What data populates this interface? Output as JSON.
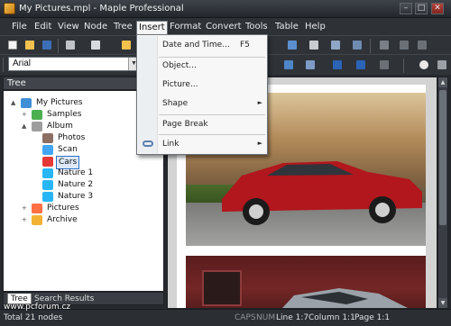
{
  "window": {
    "title": "My Pictures.mpl - Maple Professional",
    "minimize_glyph": "–",
    "maximize_glyph": "□",
    "close_glyph": "✕"
  },
  "menubar": {
    "items": [
      {
        "key": "file",
        "label": "File"
      },
      {
        "key": "edit",
        "label": "Edit"
      },
      {
        "key": "view",
        "label": "View"
      },
      {
        "key": "node",
        "label": "Node"
      },
      {
        "key": "tree",
        "label": "Tree"
      },
      {
        "key": "insert",
        "label": "Insert"
      },
      {
        "key": "format",
        "label": "Format"
      },
      {
        "key": "convert",
        "label": "Convert"
      },
      {
        "key": "tools",
        "label": "Tools"
      },
      {
        "key": "table",
        "label": "Table"
      },
      {
        "key": "help",
        "label": "Help"
      }
    ],
    "open_menu": "Insert"
  },
  "insert_menu": {
    "items": [
      {
        "label": "Date and Time...",
        "shortcut": "F5"
      },
      {
        "label": "Object..."
      },
      {
        "label": "Picture..."
      },
      {
        "label": "Shape",
        "submenu": "►"
      },
      {
        "label": "Page Break"
      },
      {
        "label": "Link",
        "submenu": "►"
      }
    ]
  },
  "format_toolbar": {
    "font_name": "Arial",
    "font_dropdown_glyph": "▼"
  },
  "tree": {
    "header": "Tree",
    "pin_glyph": "⊥",
    "nodes": [
      {
        "label": "My Pictures",
        "expander": "▲",
        "icon": "notebook-icon",
        "color": "#3f8fd6"
      },
      {
        "label": "Samples",
        "expander": "+",
        "icon": "folder-icon",
        "color": "#4caf50"
      },
      {
        "label": "Album",
        "expander": "▲",
        "icon": "folder-icon",
        "color": "#9e9e9e"
      },
      {
        "label": "Photos",
        "icon": "camera-icon",
        "color": "#8d6e63"
      },
      {
        "label": "Scan",
        "icon": "scanner-icon",
        "color": "#42a5f5"
      },
      {
        "label": "Cars",
        "icon": "car-icon",
        "color": "#e53935"
      },
      {
        "label": "Nature 1",
        "icon": "butterfly-icon",
        "color": "#29b6f6"
      },
      {
        "label": "Nature 2",
        "icon": "butterfly-icon",
        "color": "#29b6f6"
      },
      {
        "label": "Nature 3",
        "icon": "butterfly-icon",
        "color": "#29b6f6"
      },
      {
        "label": "Pictures",
        "expander": "+",
        "icon": "star-icon",
        "color": "#ff7043"
      },
      {
        "label": "Archive",
        "expander": "+",
        "icon": "box-icon",
        "color": "#f2b233"
      }
    ],
    "selected": "Cars",
    "tabs": [
      {
        "label": "Tree",
        "active": true
      },
      {
        "label": "Search Results",
        "active": false
      }
    ]
  },
  "scrollbar": {
    "up_glyph": "▲",
    "down_glyph": "▼"
  },
  "statusbar": {
    "total": "Total 21 nodes",
    "caps": "CAPS",
    "num": "NUM",
    "line": "Line 1:7",
    "column": "Column 1:1",
    "page": "Page 1:1"
  },
  "watermark": "www.pcforum.cz",
  "colors": {
    "chrome_dark": "#2e3237",
    "menu_bg": "#f7f7f7",
    "selection": "#2a6fc7"
  }
}
